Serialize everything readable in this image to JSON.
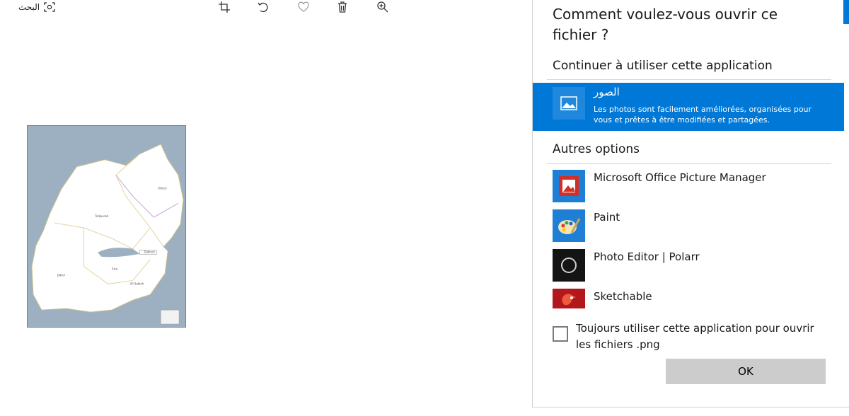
{
  "toolbar": {
    "search_label": "البحث",
    "icons": [
      "search-scan-icon",
      "crop-icon",
      "rotate-icon",
      "heart-icon",
      "trash-icon",
      "zoom-in-icon"
    ]
  },
  "map": {
    "labels": {
      "obock": "Obock",
      "tadjourah": "Tadjourah",
      "djibouti": "Djibouti",
      "dikhil": "Dikhil",
      "arta": "Arta",
      "ali_sabieh": "Ali Sabieh"
    },
    "colors": {
      "sea": "#9db0c2",
      "land": "#ffffff"
    }
  },
  "dialog": {
    "title": "Comment voulez-vous ouvrir ce fichier ?",
    "continue_heading": "Continuer à utiliser cette application",
    "selected_app": {
      "name": "الصور",
      "description": "Les photos sont facilement améliorées, organisées pour vous et prêtes à être modifiées et partagées."
    },
    "other_heading": "Autres options",
    "apps": [
      {
        "name": "Microsoft Office Picture Manager",
        "icon": "picture-manager-icon"
      },
      {
        "name": "Paint",
        "icon": "paint-palette-icon"
      },
      {
        "name": "Photo Editor | Polarr",
        "icon": "polarr-icon"
      },
      {
        "name": "Sketchable",
        "icon": "sketchable-icon"
      }
    ],
    "always_use_label": "Toujours utiliser cette application pour ouvrir les fichiers .png",
    "ok_label": "OK",
    "accent_color": "#0078d7"
  }
}
